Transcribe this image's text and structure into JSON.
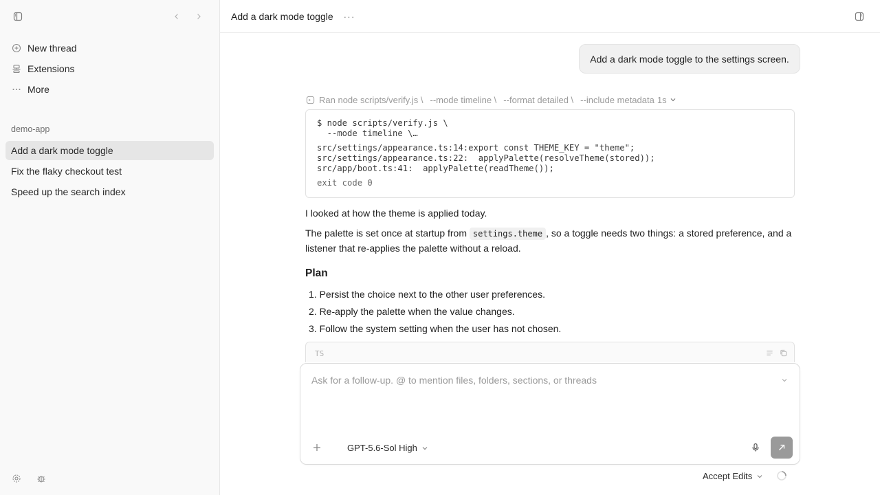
{
  "sidebar": {
    "nav": [
      {
        "label": "New thread",
        "icon": "new-thread-icon"
      },
      {
        "label": "Extensions",
        "icon": "extensions-icon"
      },
      {
        "label": "More",
        "icon": "more-icon"
      }
    ],
    "section_label": "demo-app",
    "threads": [
      {
        "label": "Add a dark mode toggle",
        "active": true
      },
      {
        "label": "Fix the flaky checkout test",
        "active": false
      },
      {
        "label": "Speed up the search index",
        "active": false
      }
    ]
  },
  "header": {
    "title": "Add a dark mode toggle",
    "more": "···"
  },
  "conversation": {
    "user_message": "Add a dark mode toggle to the settings screen.",
    "tool_call": {
      "segments": [
        "Ran node scripts/verify.js \\",
        "--mode timeline \\",
        "--format detailed \\",
        "--include metadata"
      ],
      "duration": "1s"
    },
    "code": {
      "command_lines": [
        "$ node scripts/verify.js \\",
        "  --mode timeline \\…"
      ],
      "output_lines": [
        "src/settings/appearance.ts:14:export const THEME_KEY = \"theme\";",
        "src/settings/appearance.ts:22:  applyPalette(resolveTheme(stored));",
        "src/app/boot.ts:41:  applyPalette(readTheme());"
      ],
      "exit": "exit code 0"
    },
    "para1": "I looked at how the theme is applied today.",
    "para2_before": "The palette is set once at startup from ",
    "para2_code": "settings.theme",
    "para2_after": ", so a toggle needs two things: a stored preference, and a",
    "para2_line2": "listener that re-applies the palette without a reload.",
    "plan_heading": "Plan",
    "plan_items": [
      "1. Persist the choice next to the other user preferences.",
      "2. Re-apply the palette when the value changes.",
      "3. Follow the system setting when the user has not chosen."
    ],
    "code_lang": "TS"
  },
  "composer": {
    "placeholder": "Ask for a follow-up. @ to mention files, folders, sections, or threads",
    "model": "GPT-5.6-Sol High"
  },
  "footer": {
    "accept_edits": "Accept Edits"
  }
}
